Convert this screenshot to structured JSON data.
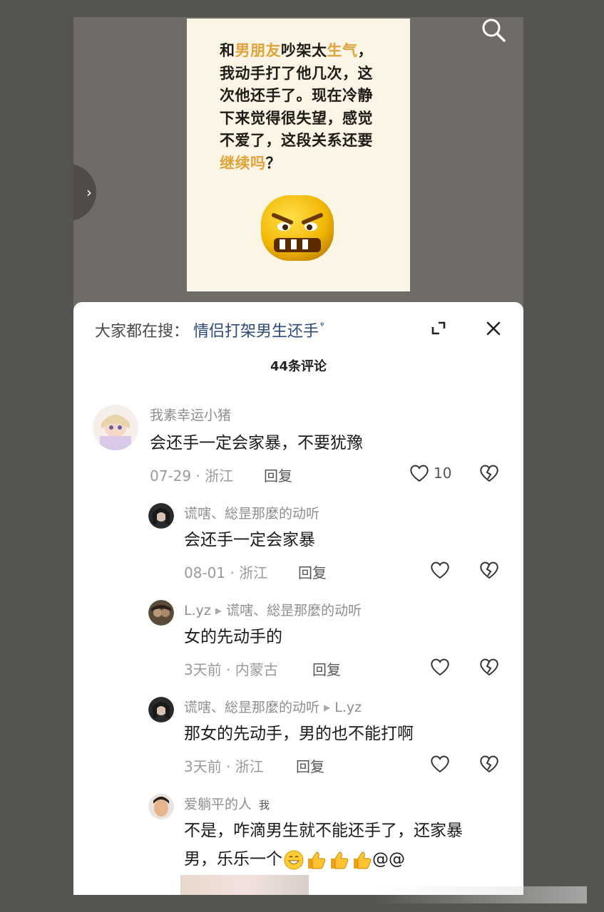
{
  "video": {
    "line1_a": "和",
    "line1_hl1": "男朋友",
    "line1_b": "吵架太",
    "line1_hl2": "生气",
    "line1_c": "，",
    "line2": "我动手打了他几次，这",
    "line3": "次他还手了。现在冷静",
    "line4": "下来觉得很失望，感觉",
    "line5": "不爱了，这段关系还要",
    "line6_hl": "继续吗",
    "line6_b": "？"
  },
  "sheet": {
    "search_label": "大家都在搜：",
    "search_term": "情侣打架男生还手",
    "search_term_icon": "ᵠ",
    "comment_count": "44条评论"
  },
  "comments": [
    {
      "name": "我素幸运小猪",
      "text": "会还手一定会家暴，不要犹豫",
      "meta": "07-29 · 浙江",
      "reply": "回复",
      "likes": "10"
    },
    {
      "name": "谎嗐、総昰那麼的动听",
      "text": "会还手一定会家暴",
      "meta": "08-01 · 浙江",
      "reply": "回复"
    },
    {
      "name": "L.yz",
      "reply_to": "谎嗐、総昰那麼的动听",
      "text": "女的先动手的",
      "meta": "3天前 · 内蒙古",
      "reply": "回复"
    },
    {
      "name": "谎嗐、総昰那麼的动听",
      "reply_to": "L.yz",
      "text": "那女的先动手，男的也不能打啊",
      "meta": "3天前 · 浙江",
      "reply": "回复"
    },
    {
      "name": "爱躺平的人",
      "me_tag": "我",
      "text_line1": "不是，咋滴男生就不能还手了，还家暴",
      "text_line2": "男，乐乐一个",
      "text_suffix": "@@"
    }
  ],
  "icons": {
    "search": "search-icon",
    "side_arrow": "chevron-right-icon",
    "expand": "expand-icon",
    "close": "close-icon",
    "like": "heart-icon",
    "dislike": "broken-heart-icon"
  },
  "colors": {
    "highlight": "#e0a33a",
    "search_term": "#2d4b78"
  }
}
